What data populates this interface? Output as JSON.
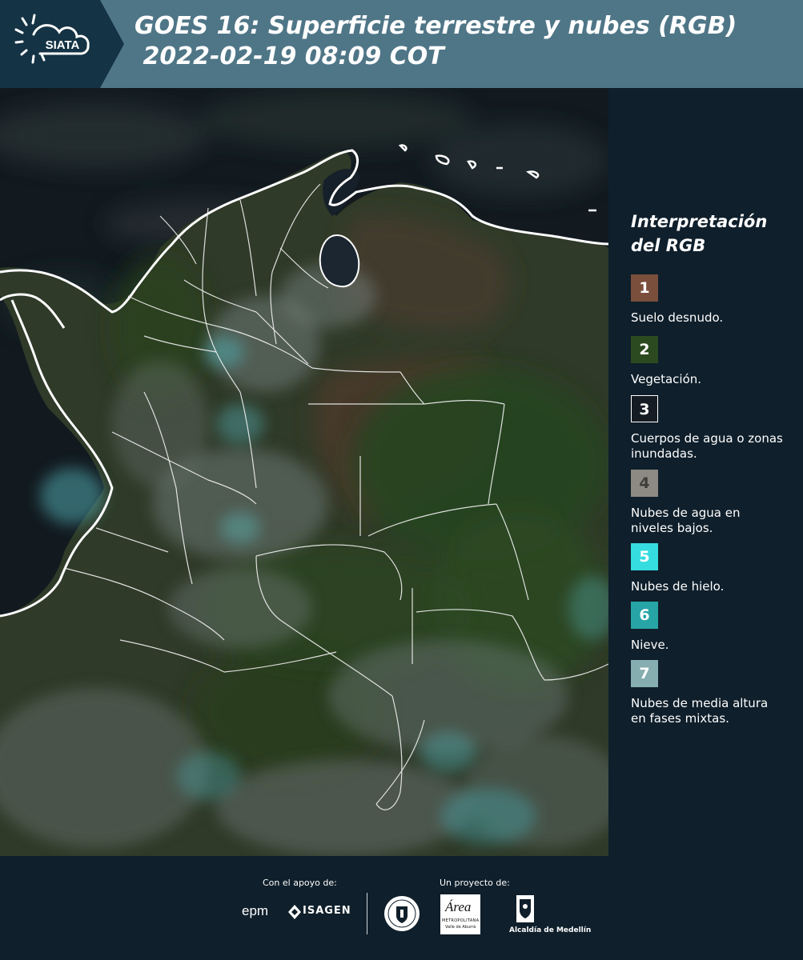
{
  "header": {
    "logo_text": "SIATA",
    "title_line1": "GOES 16: Superficie terrestre y nubes (RGB)",
    "title_line2": " 2022-02-19 08:09 COT"
  },
  "legend": {
    "title": "Interpretación del RGB",
    "items": [
      {
        "number": "1",
        "label": "Suelo desnudo.",
        "color": "#7a4f3c"
      },
      {
        "number": "2",
        "label": "Vegetación.",
        "color": "#2c4a1f"
      },
      {
        "number": "3",
        "label": "Cuerpos de agua o zonas inundadas.",
        "color": "#151c24"
      },
      {
        "number": "4",
        "label": "Nubes de agua en niveles bajos.",
        "color": "#8c8a83"
      },
      {
        "number": "5",
        "label": "Nubes de hielo.",
        "color": "#35dde0"
      },
      {
        "number": "6",
        "label": "Nieve.",
        "color": "#27a5a6"
      },
      {
        "number": "7",
        "label": "Nubes de media altura en fases mixtas.",
        "color": "#86aeb1"
      }
    ]
  },
  "footer": {
    "support_label": "Con el apoyo de:",
    "project_label": "Un proyecto de:",
    "sponsors": [
      "epm",
      "ISAGEN",
      "Área Metropolitana Valle de Aburrá",
      "Alcaldía de Medellín"
    ],
    "area_text": "Área",
    "area_sub1": "METROPOLITANA",
    "area_sub2": "Valle de Aburrá",
    "alcaldia_text": "Alcaldía de Medellín",
    "epm_text": "epm",
    "isagen_text": "ISAGEN"
  }
}
